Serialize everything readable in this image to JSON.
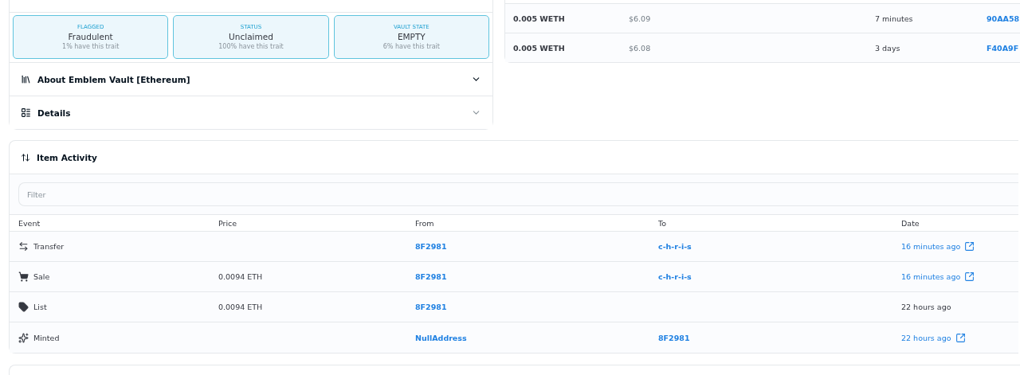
{
  "traits": [
    {
      "type": "FLAGGED",
      "value": "Fraudulent",
      "rarity": "1% have this trait"
    },
    {
      "type": "STATUS",
      "value": "Unclaimed",
      "rarity": "100% have this trait"
    },
    {
      "type": "VAULT STATE",
      "value": "EMPTY",
      "rarity": "6% have this trait"
    }
  ],
  "accordions": [
    {
      "kind": "about",
      "title": "About Emblem Vault [Ethereum]",
      "expanded": false
    },
    {
      "kind": "details",
      "title": "Details",
      "expanded": false
    }
  ],
  "offers": [
    {
      "price": "0.005 WETH",
      "usd": "$6.09",
      "expiration": "7 minutes",
      "from": "90AA58"
    },
    {
      "price": "0.005 WETH",
      "usd": "$6.08",
      "expiration": "3 days",
      "from": "F40A9F"
    }
  ],
  "activity": {
    "title": "Item Activity",
    "filter": {
      "placeholder": "Filter"
    },
    "columns": [
      "Event",
      "Price",
      "From",
      "To",
      "Date"
    ],
    "rows": [
      {
        "kind": "transfer",
        "event": "Transfer",
        "price": "",
        "from": "8F2981",
        "to": "c-h-r-i-s",
        "date": "16 minutes ago",
        "linked": true
      },
      {
        "kind": "sale",
        "event": "Sale",
        "price": "0.0094 ETH",
        "from": "8F2981",
        "to": "c-h-r-i-s",
        "date": "16 minutes ago",
        "linked": true
      },
      {
        "kind": "list",
        "event": "List",
        "price": "0.0094 ETH",
        "from": "8F2981",
        "to": "",
        "date": "22 hours ago",
        "linked": false
      },
      {
        "kind": "mint",
        "event": "Minted",
        "price": "",
        "from": "NullAddress",
        "to": "8F2981",
        "date": "22 hours ago",
        "linked": true
      }
    ]
  }
}
